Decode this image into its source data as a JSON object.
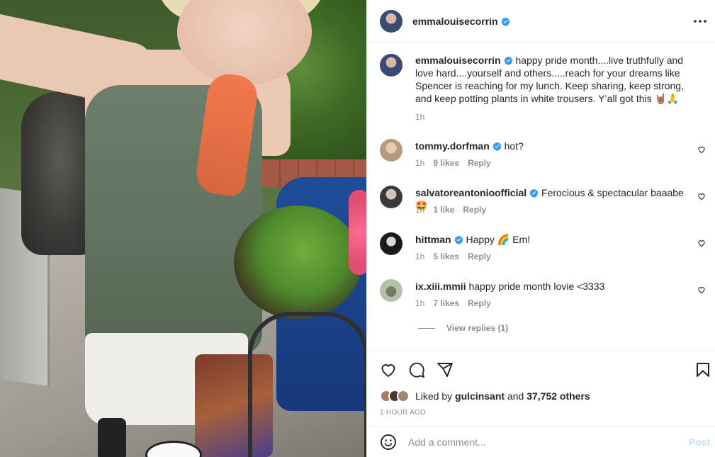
{
  "post_author": {
    "username": "emmalouisecorrin",
    "verified": true,
    "avatar": "avatar-emmalouisecorrin"
  },
  "header": {
    "more_icon": "more-horizontal-icon"
  },
  "caption": {
    "username": "emmalouisecorrin",
    "text": "happy pride month....live truthfully and love hard....yourself and others.....reach for your dreams like Spencer is reaching for my lunch. Keep sharing, keep strong, and keep potting plants in white trousers. Y’all got this 🤘🏽🙏",
    "time": "1h"
  },
  "comments": [
    {
      "username": "tommy.dorfman",
      "verified": true,
      "text": "hot?",
      "time": "1h",
      "likes": "9 likes",
      "reply": "Reply",
      "avatar_color": "#c9b49a"
    },
    {
      "username": "salvatoreantonioofficial",
      "verified": true,
      "text": "Ferocious & spectacular baaabe 🤩",
      "time": "1h",
      "likes": "1 like",
      "reply": "Reply",
      "avatar_color": "#6b6b6b"
    },
    {
      "username": "hittman",
      "verified": true,
      "text": "Happy 🌈 Em!",
      "time": "1h",
      "likes": "5 likes",
      "reply": "Reply",
      "avatar_color": "#1e1e1e"
    },
    {
      "username": "ix.xiii.mmii",
      "verified": false,
      "text": "happy pride month lovie <3333",
      "time": "1h",
      "likes": "7 likes",
      "reply": "Reply",
      "avatar_color": "#9aa58a"
    }
  ],
  "view_replies": "View replies (1)",
  "actions": {
    "like_icon": "heart-icon",
    "comment_icon": "comment-icon",
    "share_icon": "share-icon",
    "save_icon": "bookmark-icon"
  },
  "liked_by": {
    "prefix": "Liked by",
    "user": "gulcinsant",
    "connector": "and",
    "others": "37,752 others"
  },
  "timestamp": "1 HOUR AGO",
  "add_comment": {
    "placeholder": "Add a comment...",
    "post_label": "Post",
    "emoji_icon": "smiley-icon"
  },
  "colors": {
    "verified": "#3897f0",
    "muted": "#8e8e8e",
    "post_disabled": "#c0dffd",
    "text": "#262626"
  }
}
